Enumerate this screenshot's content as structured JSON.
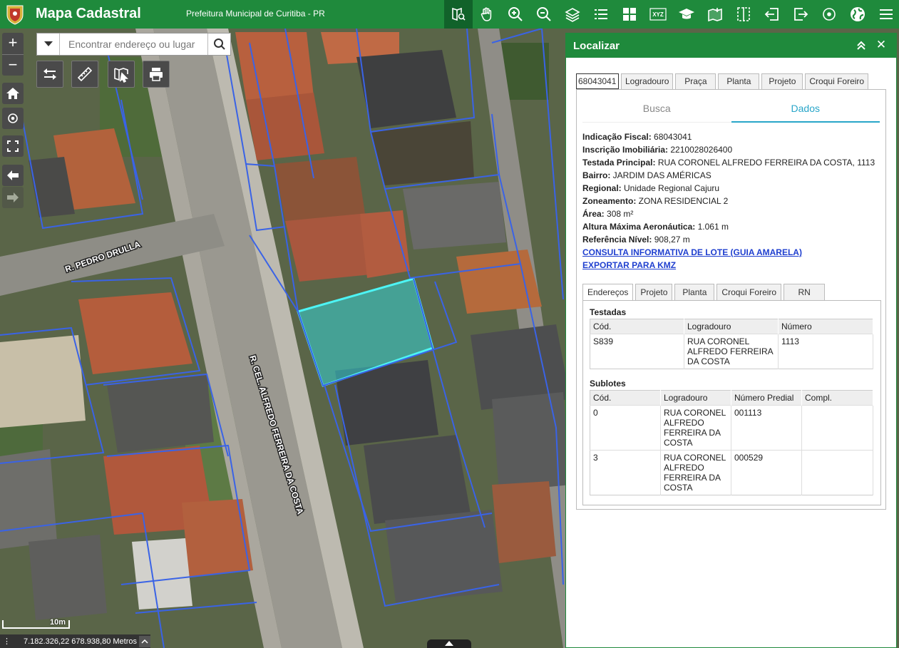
{
  "header": {
    "title": "Mapa Cadastral",
    "subtitle": "Prefeitura Municipal de Curitiba - PR"
  },
  "toolbar": [
    {
      "name": "localizar-tool",
      "icon": "map-search-icon",
      "active": true
    },
    {
      "name": "pan-tool",
      "icon": "hand-icon"
    },
    {
      "name": "zoom-in-tool",
      "icon": "zoom-in-icon"
    },
    {
      "name": "zoom-out-tool",
      "icon": "zoom-out-icon"
    },
    {
      "name": "layers-tool",
      "icon": "layers-icon"
    },
    {
      "name": "legend-tool",
      "icon": "list-icon"
    },
    {
      "name": "basemap-tool",
      "icon": "grid-icon"
    },
    {
      "name": "xyz-tool",
      "icon": "xyz-icon",
      "label": "XYZ"
    },
    {
      "name": "education-tool",
      "icon": "graduation-cap-icon"
    },
    {
      "name": "add-data-tool",
      "icon": "map-add-icon"
    },
    {
      "name": "compare-tool",
      "icon": "split-icon"
    },
    {
      "name": "import-tool",
      "icon": "import-icon"
    },
    {
      "name": "export-tool",
      "icon": "export-icon"
    },
    {
      "name": "location-tool",
      "icon": "target-icon"
    },
    {
      "name": "globe-tool",
      "icon": "globe-icon"
    },
    {
      "name": "menu-tool",
      "icon": "menu-icon"
    }
  ],
  "search": {
    "placeholder": "Encontrar endereço ou lugar"
  },
  "map": {
    "street_labels": [
      "R. PEDRO DRULLA",
      "R. CEL. ALFREDO FERREIRA DA COSTA"
    ],
    "scale_label": "10m",
    "coordinates": "7.182.326,22 678.938,80 Metros"
  },
  "panel": {
    "title": "Localizar",
    "search_tabs": {
      "input_value": "68043041",
      "labels": [
        "Logradouro",
        "Praça",
        "Planta",
        "Projeto",
        "Croqui Foreiro"
      ]
    },
    "subtabs": [
      "Busca",
      "Dados"
    ],
    "details": [
      {
        "label": "Indicação Fiscal:",
        "value": " 68043041"
      },
      {
        "label": "Inscrição Imobiliária:",
        "value": " 2210028026400"
      },
      {
        "label": "Testada Principal:",
        "value": " RUA CORONEL ALFREDO FERREIRA DA COSTA, 1113"
      },
      {
        "label": "Bairro:",
        "value": " JARDIM DAS AMÉRICAS"
      },
      {
        "label": "Regional:",
        "value": " Unidade Regional Cajuru"
      },
      {
        "label": "Zoneamento:",
        "value": " ZONA RESIDENCIAL 2"
      },
      {
        "label": "Área:",
        "value": " 308 m²"
      },
      {
        "label": "Altura Máxima Aeronáutica:",
        "value": " 1.061 m"
      },
      {
        "label": "Referência Nível:",
        "value": " 908,27 m"
      }
    ],
    "links": [
      "CONSULTA INFORMATIVA DE LOTE (GUIA AMARELA)",
      "EXPORTAR PARA KMZ"
    ],
    "detail_tabs": [
      "Endereços",
      "Projeto",
      "Planta",
      "Croqui Foreiro",
      "RN"
    ],
    "testadas": {
      "title": "Testadas",
      "headers": [
        "Cód.",
        "Logradouro",
        "Número"
      ],
      "rows": [
        {
          "cod": "S839",
          "logradouro": "RUA CORONEL ALFREDO FERREIRA DA COSTA",
          "numero": "1113"
        }
      ]
    },
    "sublotes": {
      "title": "Sublotes",
      "headers": [
        "Cód.",
        "Logradouro",
        "Número Predial",
        "Compl."
      ],
      "rows": [
        {
          "cod": "0",
          "logradouro": "RUA CORONEL ALFREDO FERREIRA DA COSTA",
          "numero": "001113",
          "compl": ""
        },
        {
          "cod": "3",
          "logradouro": "RUA CORONEL ALFREDO FERREIRA DA COSTA",
          "numero": "000529",
          "compl": ""
        }
      ]
    }
  }
}
